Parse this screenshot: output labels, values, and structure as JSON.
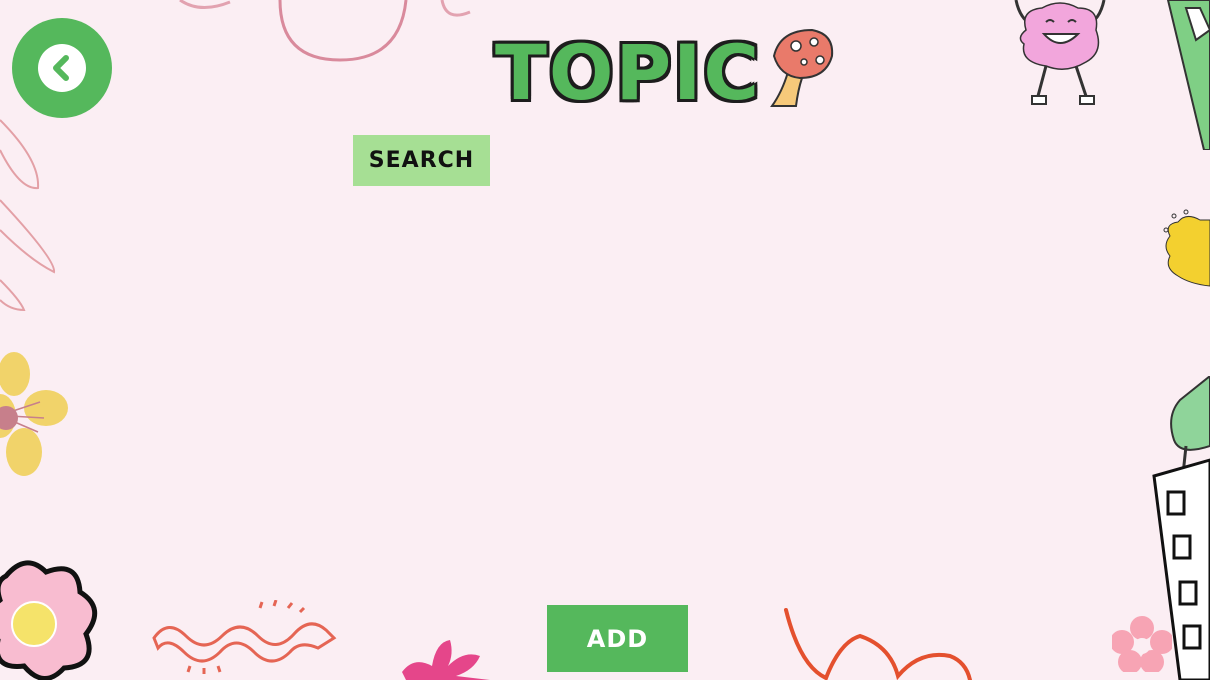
{
  "header": {
    "title": "TOPIC",
    "back_icon": "chevron-left-icon"
  },
  "search": {
    "button_label": "SEARCH",
    "input_value": "",
    "placeholder": ""
  },
  "actions": {
    "add_label": "ADD"
  },
  "colors": {
    "background": "#fbeef3",
    "accent_green": "#55b85c",
    "search_green": "#a6df94",
    "outline": "#1d1d1d"
  }
}
